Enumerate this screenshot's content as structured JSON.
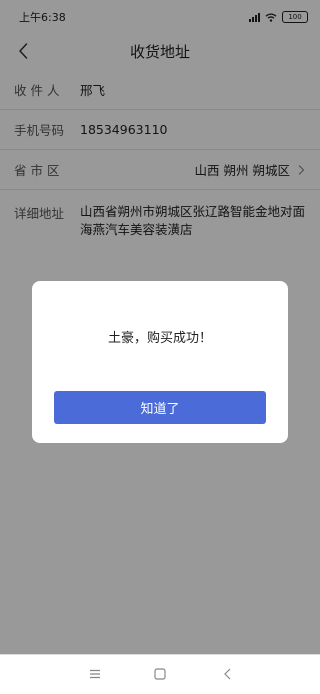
{
  "status_bar": {
    "time": "上午6:38",
    "battery": "100"
  },
  "header": {
    "title": "收货地址",
    "back_icon": "chevron-left-icon"
  },
  "form": {
    "recipient": {
      "label": "收 件 人",
      "value": "邢飞"
    },
    "phone": {
      "label": "手机号码",
      "value": "18534963110"
    },
    "region": {
      "label": "省 市 区",
      "value": "山西 朔州 朔城区"
    },
    "detail": {
      "label": "详细地址",
      "value": "山西省朔州市朔城区张辽路智能金地对面海燕汽车美容装潢店"
    }
  },
  "dialog": {
    "message": "土豪，购买成功！",
    "confirm_label": "知道了",
    "accent": "#4a6bd8"
  },
  "system_nav": {
    "icons": [
      "menu-icon",
      "home-icon",
      "back-icon"
    ]
  }
}
